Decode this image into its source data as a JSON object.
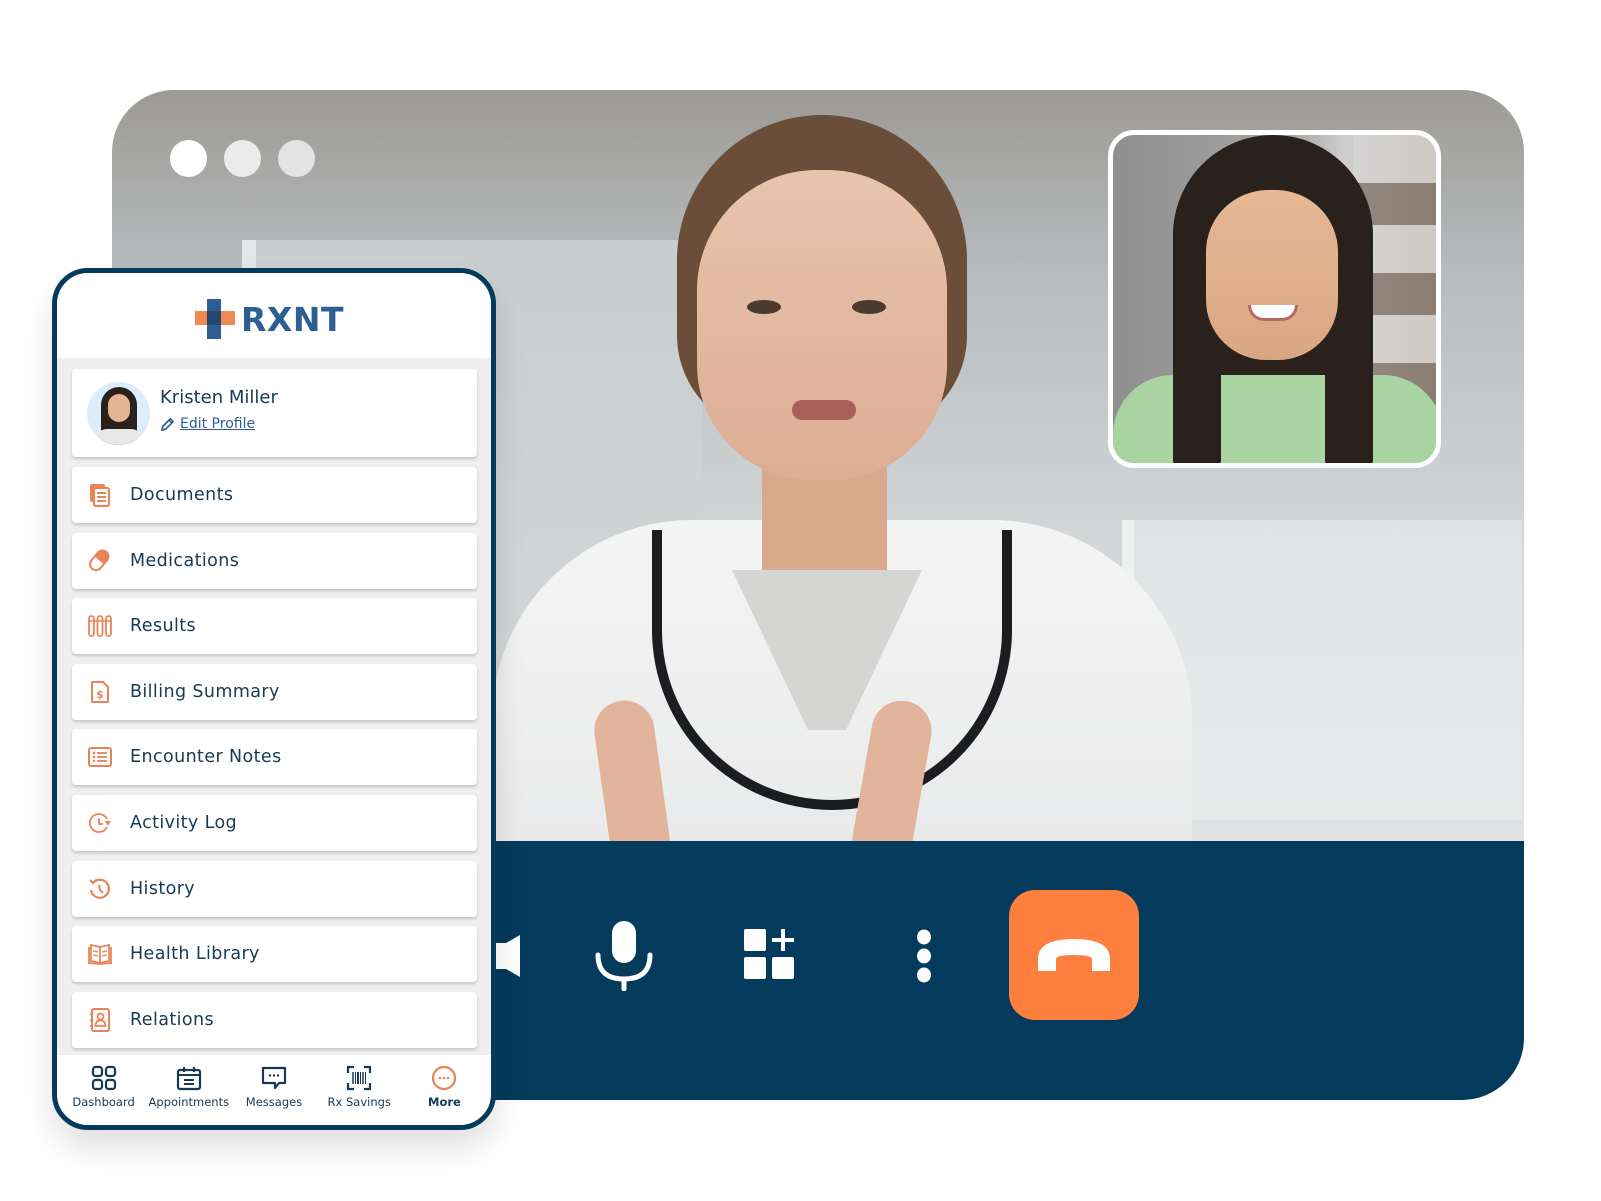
{
  "window": {
    "dots": [
      "close",
      "minimize",
      "maximize"
    ]
  },
  "call": {
    "controls": [
      {
        "id": "speaker",
        "icon": "speaker-icon",
        "label": "Speaker"
      },
      {
        "id": "mic",
        "icon": "microphone-icon",
        "label": "Microphone"
      },
      {
        "id": "apps",
        "icon": "add-apps-icon",
        "label": "Add apps"
      },
      {
        "id": "more",
        "icon": "more-vertical-icon",
        "label": "More options"
      },
      {
        "id": "hangup",
        "icon": "hang-up-icon",
        "label": "End call"
      }
    ],
    "colors": {
      "bar": "#043a5c",
      "hangup": "#ff7f3f"
    }
  },
  "app": {
    "brand": "RXNT",
    "colors": {
      "primary": "#2d5f94",
      "accent": "#f08a4f",
      "text": "#163a56",
      "border": "#043a5c"
    },
    "profile": {
      "name": "Kristen Miller",
      "edit_label": "Edit Profile"
    },
    "menu": [
      {
        "label": "Documents",
        "icon": "documents-icon"
      },
      {
        "label": "Medications",
        "icon": "pill-icon"
      },
      {
        "label": "Results",
        "icon": "test-tubes-icon"
      },
      {
        "label": "Billing Summary",
        "icon": "billing-icon"
      },
      {
        "label": "Encounter Notes",
        "icon": "list-icon"
      },
      {
        "label": "Activity Log",
        "icon": "activity-clock-icon"
      },
      {
        "label": "History",
        "icon": "history-icon"
      },
      {
        "label": "Health Library",
        "icon": "book-icon"
      },
      {
        "label": "Relations",
        "icon": "contacts-icon"
      }
    ],
    "nav": [
      {
        "label": "Dashboard",
        "icon": "grid-icon",
        "active": false
      },
      {
        "label": "Appointments",
        "icon": "calendar-icon",
        "active": false
      },
      {
        "label": "Messages",
        "icon": "chat-icon",
        "active": false
      },
      {
        "label": "Rx Savings",
        "icon": "barcode-icon",
        "active": false
      },
      {
        "label": "More",
        "icon": "more-circle-icon",
        "active": true
      }
    ]
  }
}
